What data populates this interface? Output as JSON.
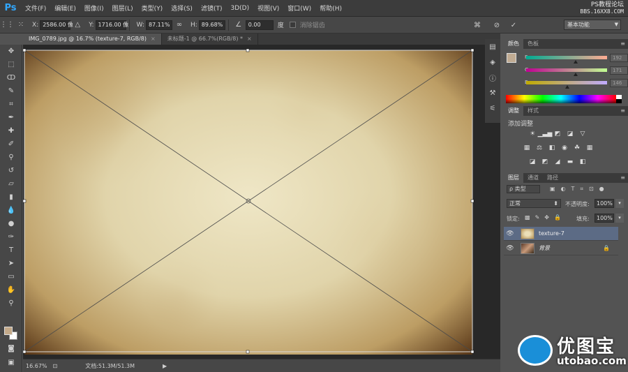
{
  "app": {
    "logo": "Ps",
    "watermark_line1": "PS教程论坛",
    "watermark_line2": "BBS.16XX8.COM"
  },
  "menu": [
    "文件(F)",
    "编辑(E)",
    "图像(I)",
    "图层(L)",
    "类型(Y)",
    "选择(S)",
    "滤镜(T)",
    "3D(D)",
    "视图(V)",
    "窗口(W)",
    "帮助(H)"
  ],
  "options": {
    "x_label": "X:",
    "x_value": "2586.00 像",
    "y_label": "Y:",
    "y_value": "1716.00 像",
    "w_label": "W:",
    "w_value": "87.11%",
    "h_label": "H:",
    "h_value": "89.68%",
    "angle_value": "0.00",
    "angle_unit": "度",
    "antialias_label": "消除锯齿",
    "workspace": "基本功能"
  },
  "tabs": [
    {
      "label": "IMG_0789.jpg @ 16.7% (texture-7, RGB/8)",
      "close": "×"
    },
    {
      "label": "未标题-1 @ 66.7%(RGB/8) *",
      "close": "×"
    }
  ],
  "status": {
    "zoom": "16.67%",
    "doc": "文档:51.3M/51.3M"
  },
  "color_panel": {
    "tabs": [
      "颜色",
      "色板"
    ],
    "r_label": "R",
    "g_label": "G",
    "b_label": "B",
    "r_value": "192",
    "g_value": "171",
    "b_value": "146",
    "foreground": "#c0ab92"
  },
  "adjust_panel": {
    "tabs": [
      "调整",
      "样式"
    ],
    "title": "添加调整"
  },
  "layers_panel": {
    "tabs": [
      "图层",
      "通道",
      "路径"
    ],
    "filter": "ρ 类型",
    "blend_mode": "正常",
    "opacity_label": "不透明度:",
    "opacity_value": "100%",
    "lock_label": "锁定:",
    "fill_label": "填充:",
    "fill_value": "100%",
    "layers": [
      {
        "name": "texture-7",
        "selected": true
      },
      {
        "name": "背景",
        "selected": false,
        "locked": true
      }
    ]
  },
  "brand": {
    "name": "优图宝",
    "url": "utobao.com"
  },
  "panel_menu_icon": "≡"
}
